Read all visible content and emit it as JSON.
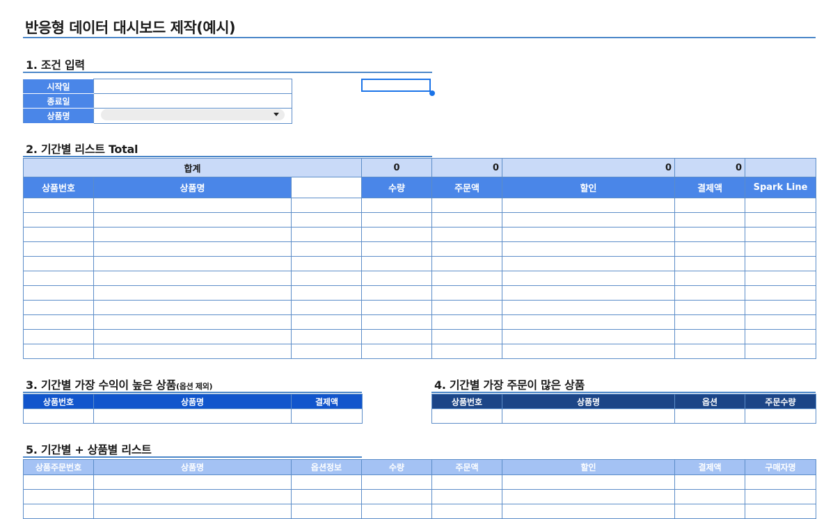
{
  "title": "반응형 데이터 대시보드 제작(예시)",
  "section1": {
    "heading": "1. 조건 입력",
    "labels": [
      "시작일",
      "종료일",
      "상품명"
    ]
  },
  "section2": {
    "heading": "2. 기간별 리스트 Total",
    "summary": {
      "label": "합계",
      "qty": "0",
      "order": "0",
      "discount": "0",
      "payment": "0"
    },
    "columns": [
      "상품번호",
      "상품명",
      "",
      "수량",
      "주문액",
      "할인",
      "결제액",
      "Spark Line"
    ]
  },
  "section3": {
    "heading": "3. 기간별 가장 수익이 높은 상품",
    "note": "(옵션 제외)",
    "columns": [
      "상품번호",
      "상품명",
      "결제액"
    ]
  },
  "section4": {
    "heading": "4. 기간별 가장 주문이 많은 상품",
    "columns": [
      "상품번호",
      "상품명",
      "옵션",
      "주문수량"
    ]
  },
  "section5": {
    "heading": "5. 기간별 + 상품별 리스트",
    "columns": [
      "상품주문번호",
      "상품명",
      "옵션정보",
      "수량",
      "주문액",
      "할인",
      "결제액",
      "구매자명"
    ]
  },
  "colors": {
    "accent": "#4a86e8",
    "dark": "#1c4587",
    "medium": "#1155cc",
    "light": "#a4c2f4",
    "summary": "#c9daf8"
  }
}
